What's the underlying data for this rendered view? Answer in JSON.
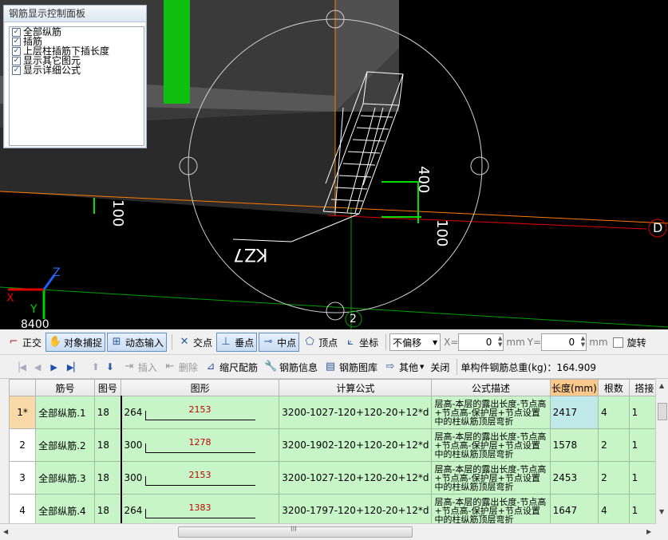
{
  "viewport": {
    "dim_400": "400",
    "dim_100_right": "100",
    "dim_100_left": "100",
    "column_label": "KZ7",
    "axis_d": "D",
    "axis_2": "2",
    "coord_8400": "8400",
    "axis_z": "Z",
    "axis_x": "X",
    "axis_y": "Y"
  },
  "control_panel": {
    "title": "钢筋显示控制面板",
    "options": [
      {
        "label": "全部纵筋",
        "checked": true
      },
      {
        "label": "插筋",
        "checked": true
      },
      {
        "label": "上层柱插筋下插长度",
        "checked": true
      },
      {
        "label": "显示其它图元",
        "checked": true
      },
      {
        "label": "显示详细公式",
        "checked": true
      }
    ]
  },
  "toolbar1": {
    "ortho": "正交",
    "snap": "对象捕捉",
    "dynamic_input": "动态输入",
    "intersection": "交点",
    "perpendicular": "垂点",
    "midpoint": "中点",
    "vertex": "顶点",
    "coordinate": "坐标",
    "offset_select": "不偏移",
    "x_label": "X=",
    "x_value": "0",
    "mm1": "mm",
    "y_label": "Y=",
    "y_value": "0",
    "mm2": "mm",
    "rotate": "旋转"
  },
  "toolbar2": {
    "insert": "插入",
    "delete": "删除",
    "scale_rebar": "缩尺配筋",
    "rebar_info": "钢筋信息",
    "rebar_library": "钢筋图库",
    "other": "其他",
    "close": "关闭",
    "total_weight": "单构件钢筋总重(kg)：164.909"
  },
  "table": {
    "headers": [
      "筋号",
      "图号",
      "图形",
      "计算公式",
      "公式描述",
      "长度(mm)",
      "根数",
      "搭接"
    ],
    "rows": [
      {
        "idx": "1*",
        "name": "全部纵筋.1",
        "fig": "18",
        "hook": "264",
        "shape_len": "2153",
        "formula": "3200-1027-120+120-20+12*d",
        "desc": "层高-本层的露出长度-节点高+节点高-保护层+节点设置中的柱纵筋顶层弯折",
        "length": "2417",
        "count": "4",
        "lap": "1"
      },
      {
        "idx": "2",
        "name": "全部纵筋.2",
        "fig": "18",
        "hook": "300",
        "shape_len": "1278",
        "formula": "3200-1902-120+120-20+12*d",
        "desc": "层高-本层的露出长度-节点高+节点高-保护层+节点设置中的柱纵筋顶层弯折",
        "length": "1578",
        "count": "2",
        "lap": "1"
      },
      {
        "idx": "3",
        "name": "全部纵筋.3",
        "fig": "18",
        "hook": "300",
        "shape_len": "2153",
        "formula": "3200-1027-120+120-20+12*d",
        "desc": "层高-本层的露出长度-节点高+节点高-保护层+节点设置中的柱纵筋顶层弯折",
        "length": "2453",
        "count": "2",
        "lap": "1"
      },
      {
        "idx": "4",
        "name": "全部纵筋.4",
        "fig": "18",
        "hook": "264",
        "shape_len": "1383",
        "formula": "3200-1797-120+120-20+12*d",
        "desc": "层高-本层的露出长度-节点高+节点高-保护层+节点设置中的柱纵筋顶层弯折",
        "length": "1647",
        "count": "4",
        "lap": "1"
      }
    ]
  },
  "scrollbar": {
    "grip": "III"
  }
}
